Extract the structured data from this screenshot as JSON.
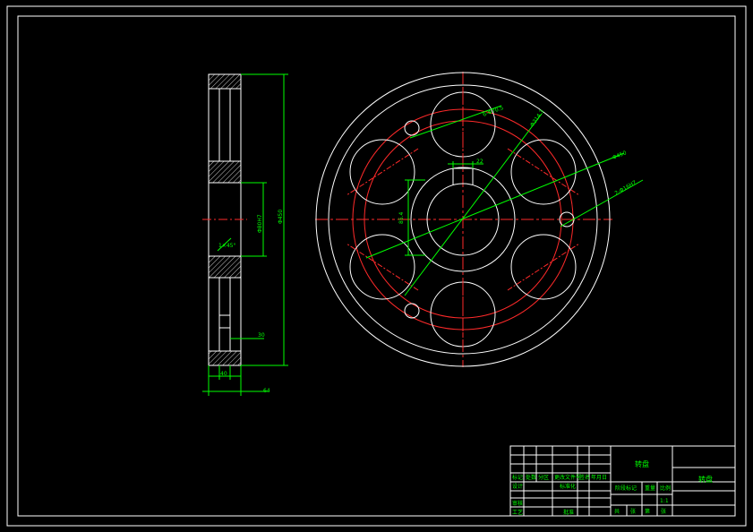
{
  "colors": {
    "background": "#000000",
    "outline": "#ffffff",
    "centerline": "#ff2a2a",
    "dimension": "#00ff00",
    "hatch": "#c8c8c8"
  },
  "side_view": {
    "dims": {
      "overall_diameter": "Φ450",
      "bore": "Φ80H7",
      "width": "64",
      "hub": "40",
      "groove": "30",
      "chamfer": "1×45°"
    }
  },
  "front_view": {
    "dims": {
      "hole_circle": "6-Φ70.5",
      "pitch_circle": "Φ314.3",
      "outer": "Φ450",
      "pin_holes": "2-Φ16H7",
      "keyway_depth": "85.4",
      "keyway_width": "22"
    }
  },
  "title_block": {
    "part_name": "转盘",
    "drawing_no": "转盘",
    "scale": "1:1",
    "row_labels": [
      "标记",
      "处数",
      "分区",
      "更改文件号",
      "签名",
      "年月日"
    ],
    "designer_label": "设计",
    "standard_label": "标准化",
    "review_label": "审核",
    "process_label": "工艺",
    "approve_label": "批准",
    "stage_label": "阶段标记",
    "weight_label": "重量",
    "scale_label": "比例",
    "sheet_label": "共",
    "sheet_of": "张",
    "page_label": "第"
  }
}
